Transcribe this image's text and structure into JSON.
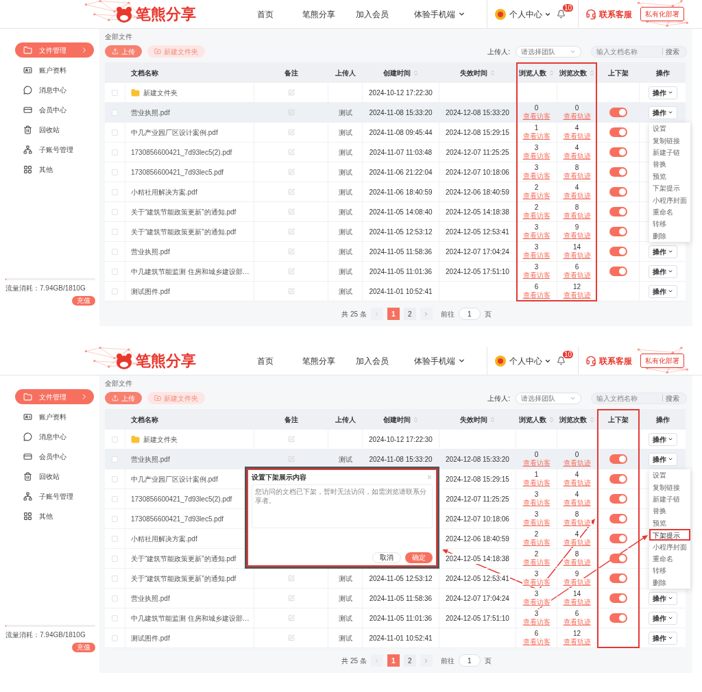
{
  "screens": [
    {
      "header": {
        "logo": "笔熊分享",
        "nav": [
          {
            "label": "首页",
            "dropdown": false
          },
          {
            "label": "笔熊分享",
            "dropdown": false
          },
          {
            "label": "加入会员",
            "dropdown": false
          },
          {
            "label": "体验手机端",
            "dropdown": true
          }
        ],
        "user": "个人中心",
        "bell_badge": "10",
        "service": "联系客服",
        "deploy": "私有化部署"
      },
      "sidebar": {
        "items": [
          {
            "label": "文件管理",
            "selected": true
          },
          {
            "label": "账户资料",
            "selected": false
          },
          {
            "label": "消息中心",
            "selected": false
          },
          {
            "label": "会员中心",
            "selected": false
          },
          {
            "label": "回收站",
            "selected": false
          },
          {
            "label": "子账号管理",
            "selected": false
          },
          {
            "label": "其他",
            "selected": false
          }
        ],
        "usage": {
          "label": "流量消耗：7.94GB/1810G",
          "level": 0.005,
          "button": "充值"
        }
      },
      "breadcrumb": "全部文件",
      "toolbar": {
        "buttons": [
          {
            "label": "上传",
            "disabled": false
          },
          {
            "label": "新建文件夹",
            "disabled": true
          }
        ],
        "filter_label": "上传人:",
        "team_select": {
          "placeholder": "请选择团队"
        },
        "search": {
          "placeholder": "输入文档名称",
          "button": "搜索"
        }
      },
      "table": {
        "columns": [
          {
            "label": "文档名称",
            "sortable": false,
            "highlighted": false
          },
          {
            "label": "备注",
            "sortable": false,
            "highlighted": false
          },
          {
            "label": "上传人",
            "sortable": false,
            "highlighted": false
          },
          {
            "label": "创建时间",
            "sortable": true,
            "highlighted": false
          },
          {
            "label": "失效时间",
            "sortable": true,
            "highlighted": false
          },
          {
            "label": "浏览人数",
            "sortable": true,
            "highlighted": true
          },
          {
            "label": "浏览次数",
            "sortable": true,
            "highlighted": true
          },
          {
            "label": "上下架",
            "sortable": false,
            "highlighted": false
          },
          {
            "label": "操作",
            "sortable": false,
            "highlighted": false
          }
        ],
        "rows": [
          {
            "kind": "folder",
            "checked": false,
            "selected": false,
            "name": "新建文件夹",
            "note_icon": true,
            "created": "2024-10-12 17:22:30",
            "action": "操作"
          },
          {
            "kind": "file",
            "checked": false,
            "selected": true,
            "name": "营业执照.pdf",
            "note_icon": true,
            "uploader": "测试",
            "created": "2024-11-08 15:33:20",
            "expires": "2024-12-08 15:33:20",
            "viewers": {
              "count": "0",
              "link": "查看访客"
            },
            "views": {
              "count": "0",
              "link": "查看轨迹"
            },
            "switch": {
              "on": true
            },
            "action": "操作"
          },
          {
            "kind": "file",
            "checked": false,
            "selected": false,
            "name": "中几产业园厂区设计案例.pdf",
            "note_icon": true,
            "uploader": "测试",
            "created": "2024-11-08 09:45:44",
            "expires": "2024-12-08 15:29:15",
            "viewers": {
              "count": "1",
              "link": "查看访客"
            },
            "views": {
              "count": "4",
              "link": "查看轨迹"
            },
            "switch": {
              "on": true
            }
          },
          {
            "kind": "file",
            "checked": false,
            "selected": false,
            "name": "1730856600421_7d93lec5(2).pdf",
            "note_icon": true,
            "uploader": "测试",
            "created": "2024-11-07 11:03:48",
            "expires": "2024-12-07 11:25:25",
            "viewers": {
              "count": "3",
              "link": "查看访客"
            },
            "views": {
              "count": "4",
              "link": "查看轨迹"
            },
            "switch": {
              "on": true
            }
          },
          {
            "kind": "file",
            "checked": false,
            "selected": false,
            "name": "1730856600421_7d93lec5.pdf",
            "note_icon": true,
            "uploader": "测试",
            "created": "2024-11-06 21:22:04",
            "expires": "2024-12-07 10:18:06",
            "viewers": {
              "count": "3",
              "link": "查看访客"
            },
            "views": {
              "count": "8",
              "link": "查看轨迹"
            },
            "switch": {
              "on": true
            }
          },
          {
            "kind": "file",
            "checked": false,
            "selected": false,
            "name": "小精社用解决方案.pdf",
            "note_icon": true,
            "uploader": "测试",
            "created": "2024-11-06 18:40:59",
            "expires": "2024-12-06 18:40:59",
            "viewers": {
              "count": "2",
              "link": "查看访客"
            },
            "views": {
              "count": "4",
              "link": "查看轨迹"
            },
            "switch": {
              "on": true
            }
          },
          {
            "kind": "file",
            "checked": false,
            "selected": false,
            "name": "关于“建筑节能政策更新”的通知.pdf",
            "note_icon": true,
            "uploader": "测试",
            "created": "2024-11-05 14:08:40",
            "expires": "2024-12-05 14:18:38",
            "viewers": {
              "count": "2",
              "link": "查看访客"
            },
            "views": {
              "count": "8",
              "link": "查看轨迹"
            },
            "switch": {
              "on": true
            }
          },
          {
            "kind": "file",
            "checked": false,
            "selected": false,
            "name": "关于“建筑节能政策更新”的通知.pdf",
            "note_icon": true,
            "uploader": "测试",
            "created": "2024-11-05 12:53:12",
            "expires": "2024-12-05 12:53:41",
            "viewers": {
              "count": "3",
              "link": "查看访客"
            },
            "views": {
              "count": "9",
              "link": "查看轨迹"
            },
            "switch": {
              "on": true
            }
          },
          {
            "kind": "file",
            "checked": false,
            "selected": false,
            "name": "营业执照.pdf",
            "note_icon": true,
            "uploader": "测试",
            "created": "2024-11-05 11:58:36",
            "expires": "2024-12-07 17:04:24",
            "viewers": {
              "count": "3",
              "link": "查看访客"
            },
            "views": {
              "count": "14",
              "link": "查看轨迹"
            },
            "switch": {
              "on": true
            },
            "action": "操作"
          },
          {
            "kind": "file",
            "checked": false,
            "selected": false,
            "name": "中几建筑节能监测 住房和城乡建设部…",
            "note_icon": true,
            "uploader": "测试",
            "created": "2024-11-05 11:01:36",
            "expires": "2024-12-05 17:51:10",
            "viewers": {
              "count": "3",
              "link": "查看访客"
            },
            "views": {
              "count": "6",
              "link": "查看轨迹"
            },
            "switch": {
              "on": true
            },
            "action": "操作"
          },
          {
            "kind": "file",
            "checked": false,
            "selected": false,
            "name": "测试图件.pdf",
            "note_icon": true,
            "uploader": "测试",
            "created": "2024-11-01 10:52:41",
            "viewers": {
              "count": "6",
              "link": "查看访客"
            },
            "views": {
              "count": "12",
              "link": "查看轨迹"
            },
            "action": "操作"
          }
        ]
      },
      "menu": {
        "items": [
          {
            "label": "设置",
            "highlighted": false
          },
          {
            "label": "复制链接",
            "highlighted": false
          },
          {
            "label": "新建子链",
            "highlighted": false
          },
          {
            "label": "替换",
            "highlighted": false
          },
          {
            "label": "预览",
            "highlighted": false
          },
          {
            "label": "下架提示",
            "highlighted": false
          },
          {
            "label": "小程序封面",
            "highlighted": false
          },
          {
            "label": "重命名",
            "highlighted": false
          },
          {
            "label": "转移",
            "highlighted": false
          },
          {
            "label": "删除",
            "highlighted": false
          }
        ]
      },
      "pagination": {
        "total": "共 25 条",
        "pages": [
          {
            "label": "1",
            "selected": true
          },
          {
            "label": "2",
            "selected": false
          }
        ],
        "goto": "前往",
        "page_value": "1",
        "unit": "页"
      }
    },
    {
      "header": {
        "logo": "笔熊分享",
        "nav": [
          {
            "label": "首页",
            "dropdown": false
          },
          {
            "label": "笔熊分享",
            "dropdown": false
          },
          {
            "label": "加入会员",
            "dropdown": false
          },
          {
            "label": "体验手机端",
            "dropdown": true
          }
        ],
        "user": "个人中心",
        "bell_badge": "10",
        "service": "联系客服",
        "deploy": "私有化部署"
      },
      "sidebar": {
        "items": [
          {
            "label": "文件管理",
            "selected": true
          },
          {
            "label": "账户资料",
            "selected": false
          },
          {
            "label": "消息中心",
            "selected": false
          },
          {
            "label": "会员中心",
            "selected": false
          },
          {
            "label": "回收站",
            "selected": false
          },
          {
            "label": "子账号管理",
            "selected": false
          },
          {
            "label": "其他",
            "selected": false
          }
        ],
        "usage": {
          "label": "流量消耗：7.94GB/1810G",
          "level": 0.005,
          "button": "充值"
        }
      },
      "breadcrumb": "全部文件",
      "toolbar": {
        "buttons": [
          {
            "label": "上传",
            "disabled": false
          },
          {
            "label": "新建文件夹",
            "disabled": true
          }
        ],
        "filter_label": "上传人:",
        "team_select": {
          "placeholder": "请选择团队"
        },
        "search": {
          "placeholder": "输入文档名称",
          "button": "搜索"
        }
      },
      "table": {
        "columns": [
          {
            "label": "文档名称",
            "sortable": false,
            "highlighted": false
          },
          {
            "label": "备注",
            "sortable": false,
            "highlighted": false
          },
          {
            "label": "上传人",
            "sortable": false,
            "highlighted": false
          },
          {
            "label": "创建时间",
            "sortable": true,
            "highlighted": false
          },
          {
            "label": "失效时间",
            "sortable": true,
            "highlighted": false
          },
          {
            "label": "浏览人数",
            "sortable": true,
            "highlighted": false
          },
          {
            "label": "浏览次数",
            "sortable": true,
            "highlighted": false
          },
          {
            "label": "上下架",
            "sortable": false,
            "highlighted": true
          },
          {
            "label": "操作",
            "sortable": false,
            "highlighted": false
          }
        ],
        "rows": [
          {
            "kind": "folder",
            "checked": false,
            "selected": false,
            "name": "新建文件夹",
            "note_icon": true,
            "created": "2024-10-12 17:22:30",
            "action": "操作"
          },
          {
            "kind": "file",
            "checked": false,
            "selected": true,
            "name": "营业执照.pdf",
            "note_icon": true,
            "uploader": "测试",
            "created": "2024-11-08 15:33:20",
            "expires": "2024-12-08 15:33:20",
            "viewers": {
              "count": "0",
              "link": "查看访客"
            },
            "views": {
              "count": "0",
              "link": "查看轨迹"
            },
            "switch": {
              "on": true
            },
            "action": "操作"
          },
          {
            "kind": "file",
            "checked": false,
            "selected": false,
            "name": "中几产业园厂区设计案例.pdf",
            "expires": "2024-12-08 15:29:15",
            "viewers": {
              "count": "1",
              "link": "查看访客"
            },
            "views": {
              "count": "4",
              "link": "查看轨迹"
            },
            "switch": {
              "on": true
            }
          },
          {
            "kind": "file",
            "checked": false,
            "selected": false,
            "name": "1730856600421_7d93lec5(2).pdf",
            "expires": "2024-12-07 11:25:25",
            "viewers": {
              "count": "3",
              "link": "查看访客"
            },
            "views": {
              "count": "4",
              "link": "查看轨迹"
            },
            "switch": {
              "on": true
            }
          },
          {
            "kind": "file",
            "checked": false,
            "selected": false,
            "name": "1730856600421_7d93lec5.pdf",
            "expires": "2024-12-07 10:18:06",
            "viewers": {
              "count": "3",
              "link": "查看访客"
            },
            "views": {
              "count": "8",
              "link": "查看轨迹"
            },
            "switch": {
              "on": true
            }
          },
          {
            "kind": "file",
            "checked": false,
            "selected": false,
            "name": "小精社用解决方案.pdf",
            "expires": "2024-12-06 18:40:59",
            "viewers": {
              "count": "2",
              "link": "查看访客"
            },
            "views": {
              "count": "4",
              "link": "查看轨迹"
            },
            "switch": {
              "on": true
            }
          },
          {
            "kind": "file",
            "checked": false,
            "selected": false,
            "name": "关于“建筑节能政策更新”的通知.pdf",
            "expires": "2024-12-05 14:18:38",
            "viewers": {
              "count": "2",
              "link": "查看访客"
            },
            "views": {
              "count": "8",
              "link": "查看轨迹"
            },
            "switch": {
              "on": true
            }
          },
          {
            "kind": "file",
            "checked": false,
            "selected": false,
            "name": "关于“建筑节能政策更新”的通知.pdf",
            "note_icon": true,
            "uploader": "测试",
            "created": "2024-11-05 12:53:12",
            "expires": "2024-12-05 12:53:41",
            "viewers": {
              "count": "3",
              "link": "查看访客"
            },
            "views": {
              "count": "9",
              "link": "查看轨迹"
            },
            "switch": {
              "on": true
            }
          },
          {
            "kind": "file",
            "checked": false,
            "selected": false,
            "name": "营业执照.pdf",
            "note_icon": true,
            "uploader": "测试",
            "created": "2024-11-05 11:58:36",
            "expires": "2024-12-07 17:04:24",
            "viewers": {
              "count": "3",
              "link": "查看访客"
            },
            "views": {
              "count": "14",
              "link": "查看轨迹"
            },
            "switch": {
              "on": true
            },
            "action": "操作"
          },
          {
            "kind": "file",
            "checked": false,
            "selected": false,
            "name": "中几建筑节能监测 住房和城乡建设部…",
            "note_icon": true,
            "uploader": "测试",
            "created": "2024-11-05 11:01:36",
            "expires": "2024-12-05 17:51:10",
            "viewers": {
              "count": "3",
              "link": "查看访客"
            },
            "views": {
              "count": "6",
              "link": "查看轨迹"
            },
            "switch": {
              "on": true
            },
            "action": "操作"
          },
          {
            "kind": "file",
            "checked": false,
            "selected": false,
            "name": "测试图件.pdf",
            "note_icon": true,
            "uploader": "测试",
            "created": "2024-11-01 10:52:41",
            "viewers": {
              "count": "6",
              "link": "查看访客"
            },
            "views": {
              "count": "12",
              "link": "查看轨迹"
            },
            "action": "操作"
          }
        ]
      },
      "menu": {
        "items": [
          {
            "label": "设置",
            "highlighted": false
          },
          {
            "label": "复制链接",
            "highlighted": false
          },
          {
            "label": "新建子链",
            "highlighted": false
          },
          {
            "label": "替换",
            "highlighted": false
          },
          {
            "label": "预览",
            "highlighted": false
          },
          {
            "label": "下架提示",
            "highlighted": true
          },
          {
            "label": "小程序封面",
            "highlighted": false
          },
          {
            "label": "重命名",
            "highlighted": false
          },
          {
            "label": "转移",
            "highlighted": false
          },
          {
            "label": "删除",
            "highlighted": false
          }
        ]
      },
      "pagination": {
        "total": "共 25 条",
        "pages": [
          {
            "label": "1",
            "selected": true
          },
          {
            "label": "2",
            "selected": false
          }
        ],
        "goto": "前往",
        "page_value": "1",
        "unit": "页"
      },
      "dialog": {
        "title": "设置下架展示内容",
        "placeholder": "您访问的文档已下架，暂时无法访问，如需浏览请联系分享者。",
        "buttons": [
          {
            "label": "取消",
            "primary": false
          },
          {
            "label": "确定",
            "primary": true
          }
        ],
        "highlighted": true
      },
      "annotation_arrows": true
    }
  ]
}
